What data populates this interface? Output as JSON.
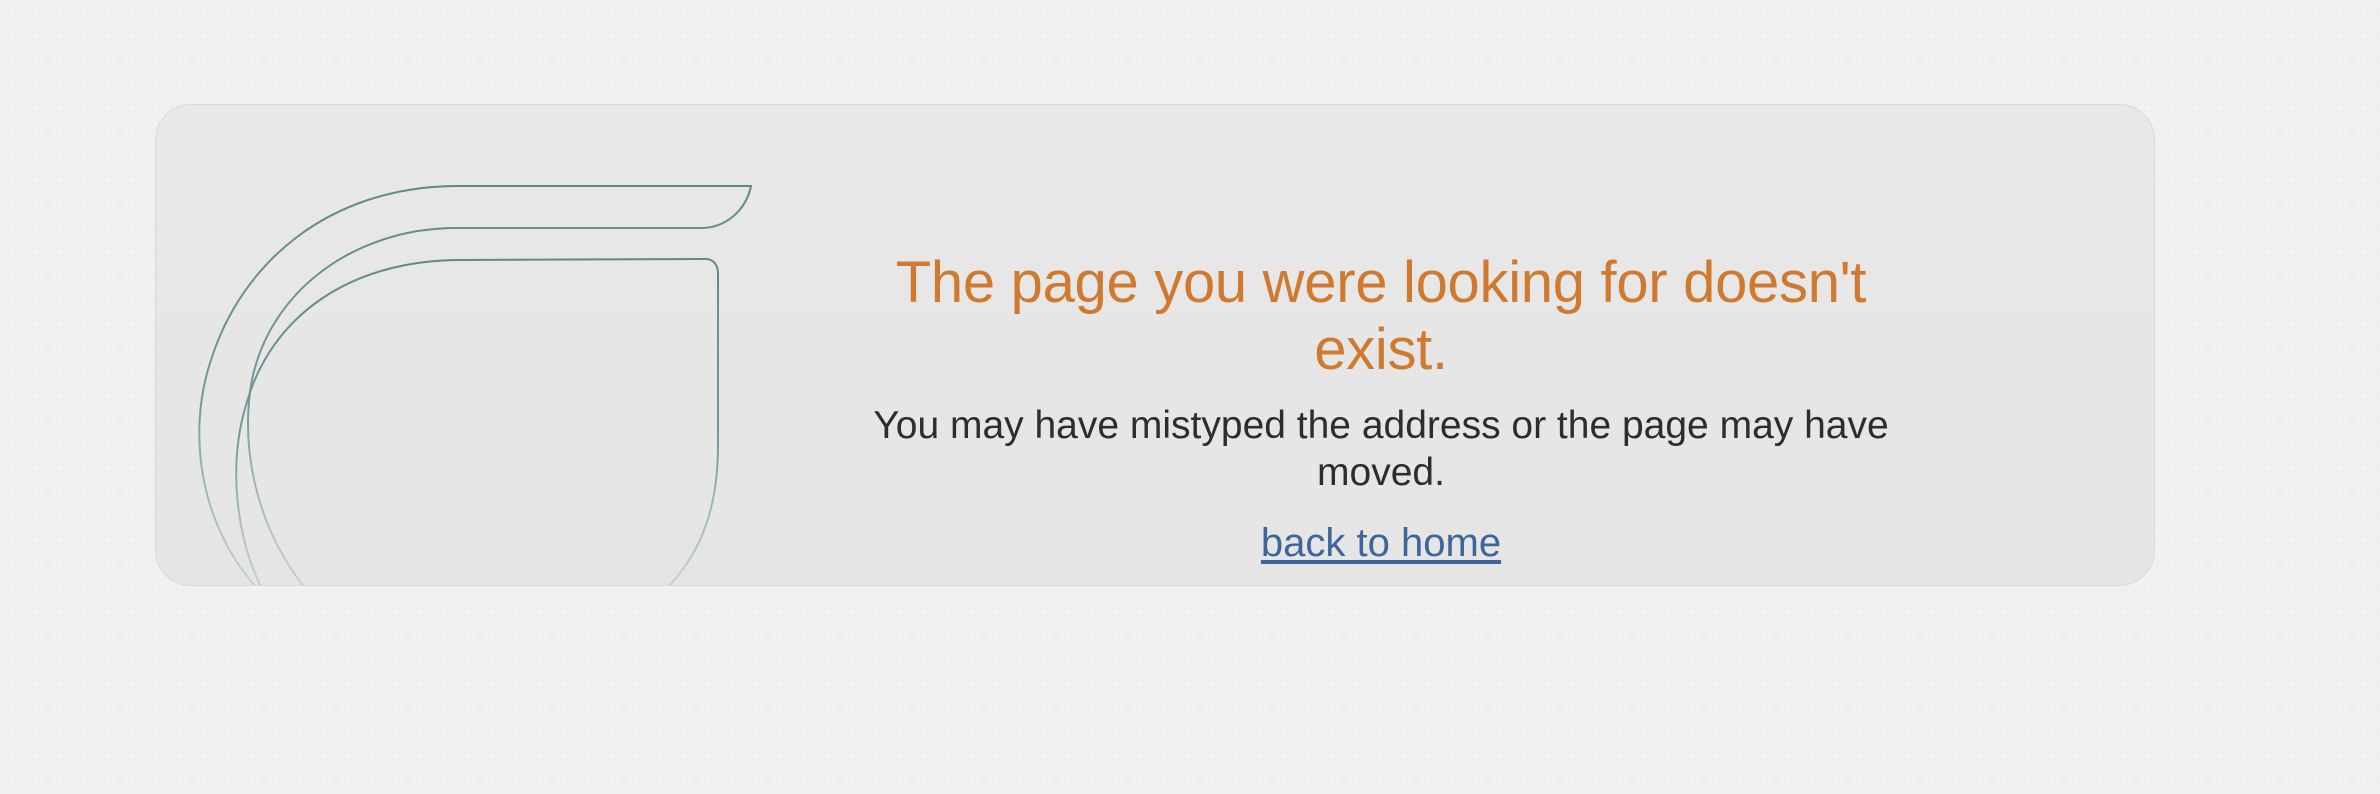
{
  "error_panel": {
    "title": "The page you were looking for doesn't exist.",
    "subtitle": "You may have mistyped the address or the page may have moved.",
    "home_link_label": "back to home"
  },
  "illustration": {
    "icon": "mug-outline-icon",
    "stroke_color": "#5e8b89"
  },
  "colors": {
    "title": "#cf7a2e",
    "link": "#3e659a",
    "text": "#2d2d2d",
    "page_background": "#f1f1f1",
    "panel_background": "#e6e6e6"
  }
}
